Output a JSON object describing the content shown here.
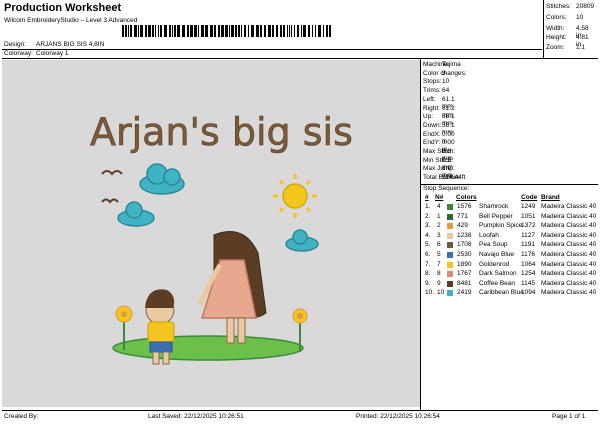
{
  "header": {
    "title": "Production Worksheet",
    "software": "Wilcom EmbroideryStudio – Level 3 Advanced",
    "design_label": "Design:",
    "design_value": "ARJANS BIG SIS 4,8IN",
    "colorway_label": "Colorway:",
    "colorway_value": "Colorway 1"
  },
  "summary": {
    "stitches_label": "Stitches:",
    "stitches": "20809",
    "colors_label": "Colors:",
    "colors": "10",
    "width_label": "Width:",
    "width": "4.58 in",
    "height_label": "Height:",
    "height": "4.81 in",
    "zoom_label": "Zoom:",
    "zoom": "1:1"
  },
  "design_text": "Arjan's big sis",
  "machine": [
    {
      "label": "Machine:",
      "value": "Tajima"
    },
    {
      "label": "Color changes:",
      "value": "9"
    },
    {
      "label": "Stops:",
      "value": "10"
    },
    {
      "label": "Trims:",
      "value": "64"
    },
    {
      "label": "Left:",
      "value": "61.1 mm"
    },
    {
      "label": "Right:",
      "value": "61.2 mm"
    },
    {
      "label": "Up:",
      "value": "58.1 mm"
    },
    {
      "label": "Down:",
      "value": "58.1 mm"
    },
    {
      "label": "EndX:",
      "value": "0.00 in"
    },
    {
      "label": "EndY:",
      "value": "0.00 in"
    },
    {
      "label": "Max Stitch:",
      "value": "6.8 mm"
    },
    {
      "label": "Min Stitch:",
      "value": "0.2 mm"
    },
    {
      "label": "Max Jump:",
      "value": "6.9 mm"
    },
    {
      "label": "Total Bobbin:",
      "value": "124.44ft"
    }
  ],
  "stop_sequence": {
    "title": "Stop Sequence:",
    "headers": [
      "#",
      "N#",
      "Colors",
      "Code",
      "Brand"
    ],
    "rows": [
      {
        "stop": "1.",
        "n": "4",
        "color": "#3a8a3a",
        "num": "1576",
        "name": "Shamrock",
        "code": "1249",
        "brand": "Madeira Classic 40"
      },
      {
        "stop": "2.",
        "n": "1",
        "color": "#2d6b2d",
        "num": "771",
        "name": "Bell Pepper",
        "code": "1051",
        "brand": "Madeira Classic 40"
      },
      {
        "stop": "3.",
        "n": "2",
        "color": "#e39a3c",
        "num": "429",
        "name": "Pumpkin Spice",
        "code": "1372",
        "brand": "Madeira Classic 40"
      },
      {
        "stop": "4.",
        "n": "3",
        "color": "#e8c9a0",
        "num": "1238",
        "name": "Loofah",
        "code": "1127",
        "brand": "Madeira Classic 40"
      },
      {
        "stop": "5.",
        "n": "6",
        "color": "#6b5a3a",
        "num": "1708",
        "name": "Pea Soup",
        "code": "1191",
        "brand": "Madeira Classic 40"
      },
      {
        "stop": "6.",
        "n": "5",
        "color": "#3b6fb5",
        "num": "2530",
        "name": "Navajo Blue",
        "code": "1176",
        "brand": "Madeira Classic 40"
      },
      {
        "stop": "7.",
        "n": "7",
        "color": "#f2c61f",
        "num": "1890",
        "name": "Goldenrod",
        "code": "1064",
        "brand": "Madeira Classic 40"
      },
      {
        "stop": "8.",
        "n": "8",
        "color": "#d98a70",
        "num": "1767",
        "name": "Dark Salmon",
        "code": "1254",
        "brand": "Madeira Classic 40"
      },
      {
        "stop": "9.",
        "n": "9",
        "color": "#5a3d22",
        "num": "8481",
        "name": "Coffee Bean",
        "code": "1145",
        "brand": "Madeira Classic 40"
      },
      {
        "stop": "10.",
        "n": "10",
        "color": "#3fb3c4",
        "num": "2419",
        "name": "Caribbean Blue",
        "code": "1094",
        "brand": "Madeira Classic 40"
      }
    ]
  },
  "footer": {
    "created": "Created By:",
    "saved": "Last Saved: 22/12/2025 10:26:51",
    "printed": "Printed: 22/12/2025 10:26:54",
    "page": "Page 1 of 1"
  }
}
